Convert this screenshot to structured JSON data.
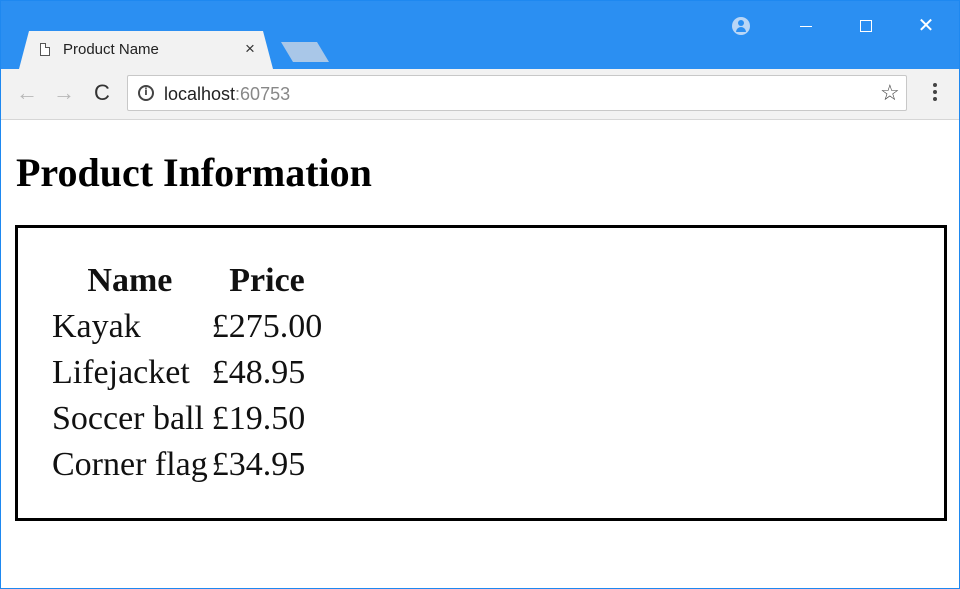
{
  "browser": {
    "tab": {
      "title": "Product Name",
      "close_glyph": "×"
    },
    "address_bar": {
      "host": "localhost",
      "port": ":60753"
    },
    "icons": {
      "page": "page-icon",
      "profile": "profile-icon",
      "back": "back-arrow-icon",
      "forward": "forward-arrow-icon",
      "reload": "reload-icon",
      "info": "info-icon",
      "star": "star-icon",
      "menu": "kebab-menu-icon"
    },
    "glyphs": {
      "back": "←",
      "forward": "→",
      "reload": "C",
      "info": "i",
      "star": "☆",
      "close": "✕"
    },
    "colors": {
      "titlebar": "#2b8ff2",
      "toolbar": "#f2f2f2"
    }
  },
  "page": {
    "heading": "Product Information",
    "table": {
      "headers": [
        "Name",
        "Price"
      ],
      "rows": [
        [
          "Kayak",
          "£275.00"
        ],
        [
          "Lifejacket",
          "£48.95"
        ],
        [
          "Soccer ball",
          "£19.50"
        ],
        [
          "Corner flag",
          "£34.95"
        ]
      ]
    }
  }
}
